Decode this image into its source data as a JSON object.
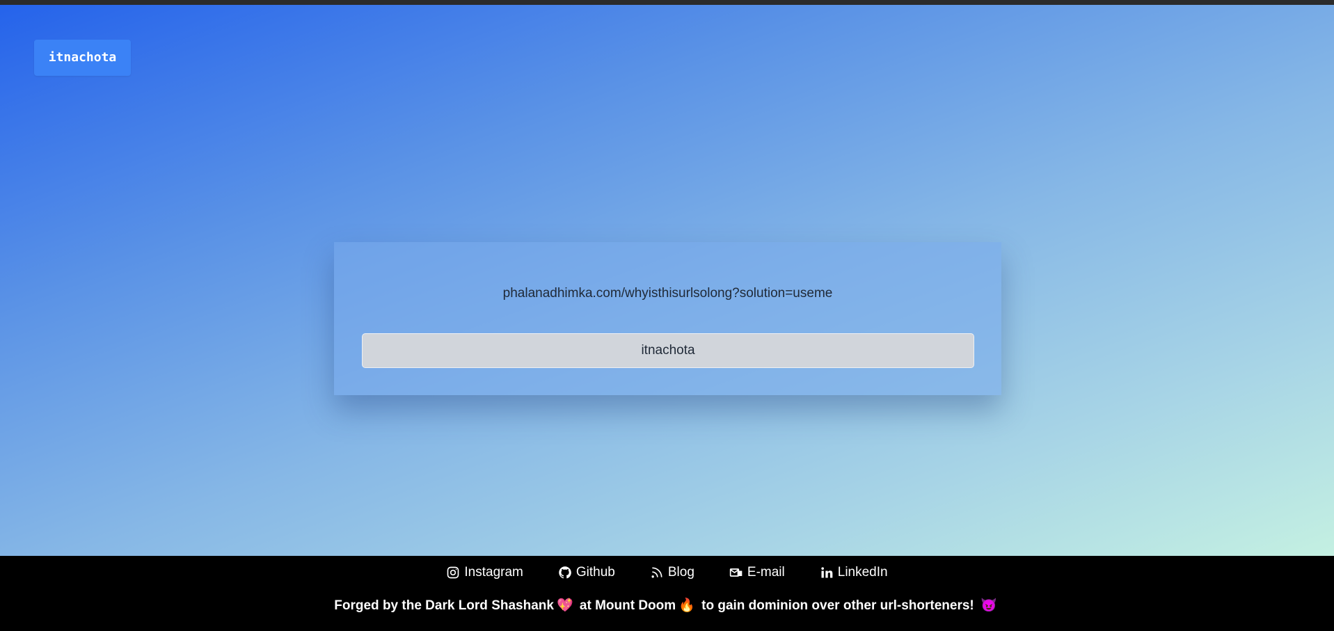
{
  "header": {
    "logo_text": "itnachota"
  },
  "card": {
    "url_text": "phalanadhimka.com/whyisthisurlsolong?solution=useme",
    "button_label": "itnachota"
  },
  "footer": {
    "links": [
      {
        "label": "Instagram",
        "icon": "instagram-icon"
      },
      {
        "label": "Github",
        "icon": "github-icon"
      },
      {
        "label": "Blog",
        "icon": "rss-icon"
      },
      {
        "label": "E-mail",
        "icon": "mail-icon"
      },
      {
        "label": "LinkedIn",
        "icon": "linkedin-icon"
      }
    ],
    "tagline_part1": "Forged by the Dark Lord Shashank",
    "tagline_emoji1": "💖",
    "tagline_part2": "at Mount Doom",
    "tagline_emoji2": "🔥",
    "tagline_part3": "to gain dominion over other url-shorteners!",
    "tagline_emoji3": "😈"
  },
  "colors": {
    "gradient_start": "#2563eb",
    "gradient_end": "#c4f0e2",
    "logo_bg": "#3b82f6",
    "button_bg": "#d1d5db",
    "footer_bg": "#000000"
  }
}
